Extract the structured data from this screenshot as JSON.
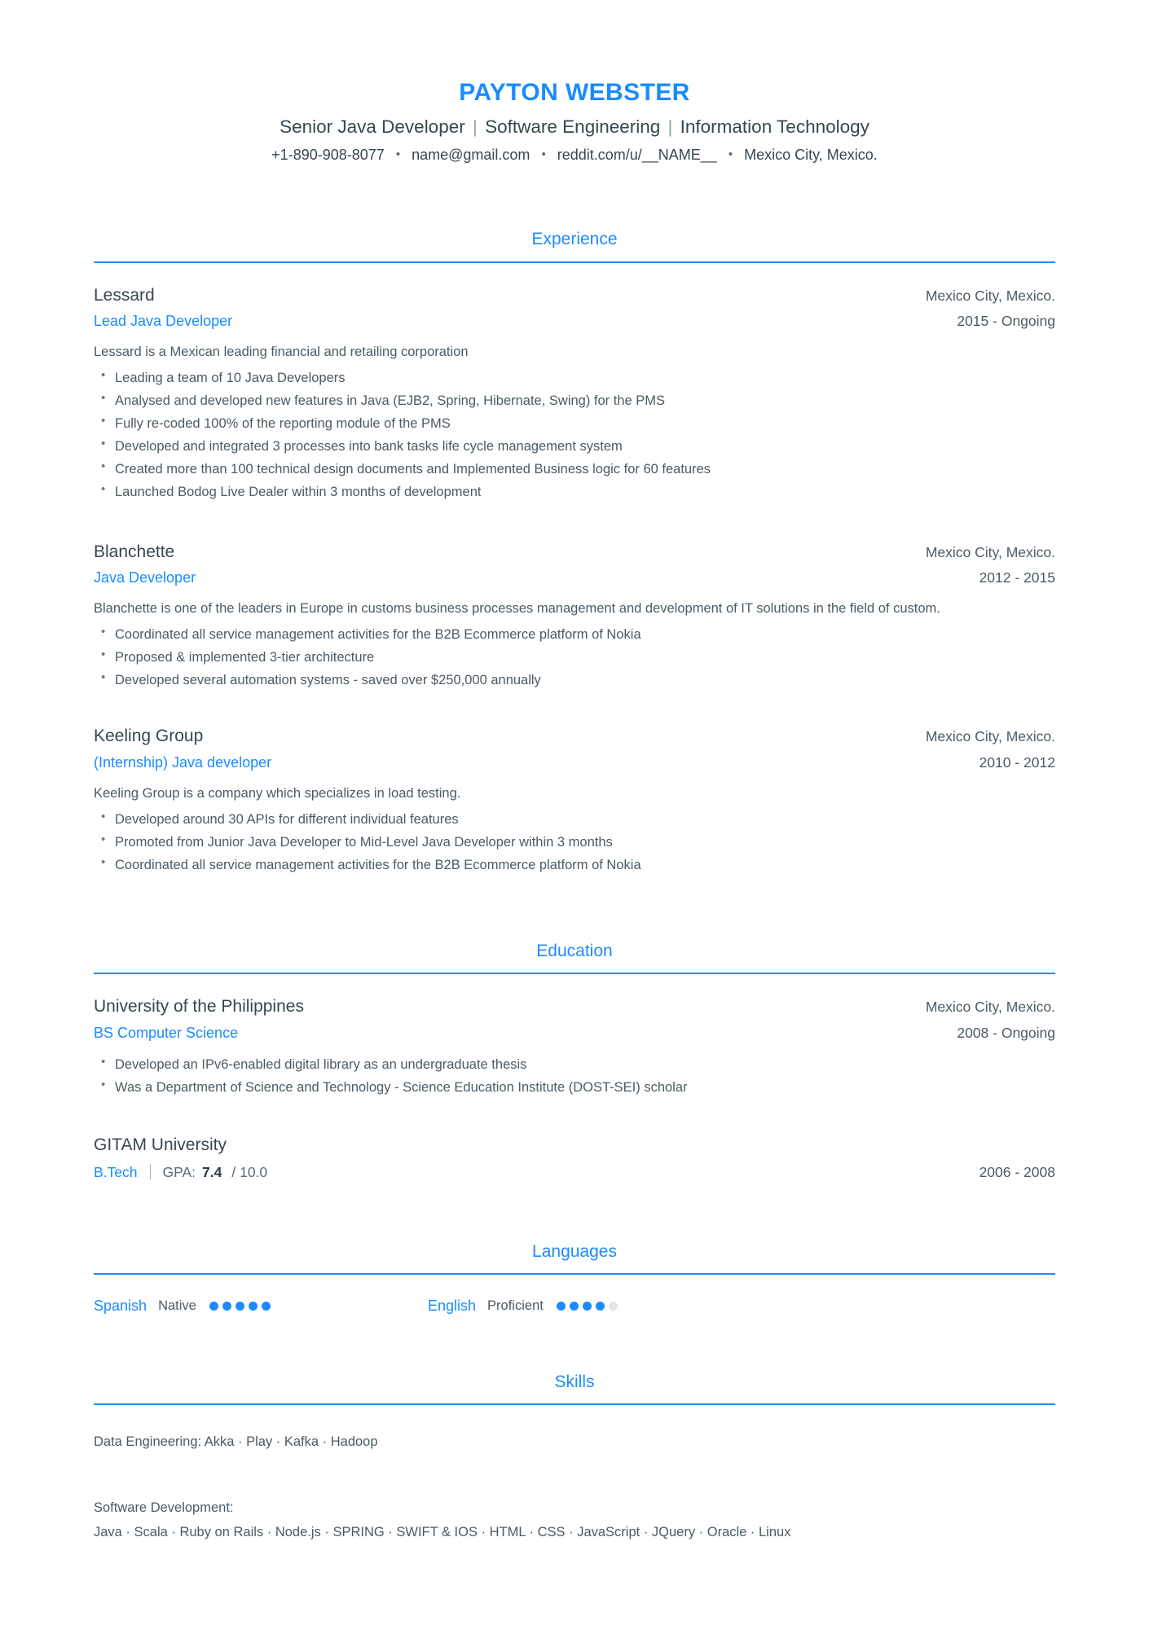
{
  "header": {
    "name": "PAYTON WEBSTER",
    "tagline_parts": [
      "Senior Java Developer",
      "Software Engineering",
      "Information Technology"
    ],
    "tagline_separator": "|",
    "contact_parts": [
      "+1-890-908-8077",
      "name@gmail.com",
      "reddit.com/u/__NAME__",
      "Mexico City, Mexico."
    ],
    "contact_separator": "•"
  },
  "accent_color": "#1a8cff",
  "text_color": "#4c5a63",
  "sections": {
    "experience": {
      "title": "Experience",
      "entries": [
        {
          "org": "Lessard",
          "place": "Mexico City, Mexico.",
          "role": "Lead Java Developer",
          "dates": "2015 - Ongoing",
          "description": "Lessard is a Mexican leading financial and retailing corporation",
          "bullets": [
            "Leading a team of 10 Java Developers",
            "Analysed and developed new features in Java (EJB2, Spring, Hibernate, Swing) for the PMS",
            "Fully re-coded 100% of the reporting module of the PMS",
            "Developed and integrated 3 processes into bank tasks life cycle management system",
            "Created more than 100 technical design documents and Implemented Business logic for 60 features",
            "Launched Bodog Live Dealer within 3 months of development"
          ]
        },
        {
          "org": "Blanchette",
          "place": "Mexico City, Mexico.",
          "role": "Java Developer",
          "dates": "2012 - 2015",
          "description": "Blanchette is one of the leaders in Europe in customs business processes management and development of IT solutions in the field of custom.",
          "bullets": [
            "Coordinated all service management activities for the B2B Ecommerce platform of Nokia",
            "Proposed & implemented 3-tier architecture",
            "Developed several automation systems - saved over $250,000 annually"
          ]
        },
        {
          "org": "Keeling Group",
          "place": "Mexico City, Mexico.",
          "role": "(Internship) Java developer",
          "dates": "2010 - 2012",
          "description": "Keeling Group is a company which specializes in load testing.",
          "bullets": [
            "Developed around 30 APIs for different individual features",
            "Promoted from Junior Java Developer to Mid-Level Java Developer within 3 months",
            "Coordinated all service management activities for the B2B Ecommerce platform of Nokia"
          ]
        }
      ]
    },
    "education": {
      "title": "Education",
      "entries": [
        {
          "org": "University of the Philippines",
          "place": "Mexico City, Mexico.",
          "role": "BS Computer Science",
          "dates": "2008 - Ongoing",
          "bullets": [
            "Developed an IPv6-enabled digital library as an undergraduate thesis",
            "Was a Department of Science and Technology - Science Education Institute (DOST-SEI) scholar"
          ]
        }
      ],
      "gitam": {
        "org": "GITAM University",
        "degree": "B.Tech",
        "gpa_label": "GPA:",
        "gpa_value": "7.4",
        "gpa_scale": "/ 10.0",
        "dates": "2006 - 2008"
      }
    },
    "languages": {
      "title": "Languages",
      "items": [
        {
          "name": "Spanish",
          "level": "Native",
          "filled": 5,
          "total": 5
        },
        {
          "name": "English",
          "level": "Proficient",
          "filled": 4,
          "total": 5
        }
      ]
    },
    "skills": {
      "title": "Skills",
      "groups": [
        {
          "heading": "",
          "line": "Data Engineering: Akka · Play · Kafka · Hadoop"
        },
        {
          "heading": "Software Development:",
          "line": "Java · Scala · Ruby on Rails · Node.js · SPRING ·  SWIFT & IOS · HTML · CSS · JavaScript · JQuery · Oracle · Linux"
        }
      ]
    }
  }
}
